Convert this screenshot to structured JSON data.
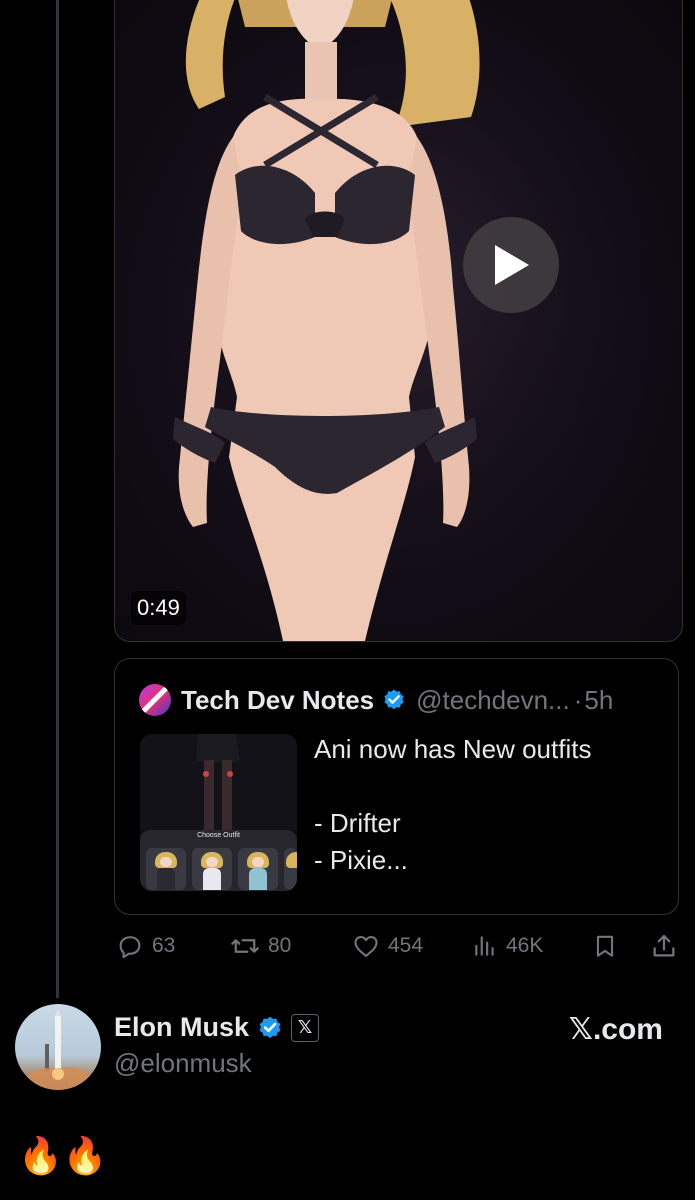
{
  "video": {
    "duration": "0:49"
  },
  "quoted_post": {
    "author_name": "Tech Dev Notes",
    "handle": "@techdevn...",
    "separator": "·",
    "time": "5h",
    "thumbnail_label": "Choose Outfit",
    "text_lines": [
      "Ani now has New outfits",
      "",
      "- Drifter",
      "- Pixie..."
    ]
  },
  "actions": {
    "replies": "63",
    "reposts": "80",
    "likes": "454",
    "views": "46K"
  },
  "reply": {
    "author_name": "Elon Musk",
    "handle": "@elonmusk",
    "affiliate_badge": "𝕏",
    "site_link": "𝕏.com",
    "text": "🔥🔥"
  },
  "colors": {
    "background": "#000000",
    "text_primary": "#e7e9ea",
    "text_secondary": "#71767b",
    "verified_blue": "#1d9bf0",
    "border": "#2f3336"
  },
  "icons": {
    "play": "play-icon",
    "verified": "verified-badge-icon",
    "reply": "reply-icon",
    "repost": "repost-icon",
    "like": "like-icon",
    "views": "views-icon",
    "bookmark": "bookmark-icon",
    "share": "share-icon"
  }
}
